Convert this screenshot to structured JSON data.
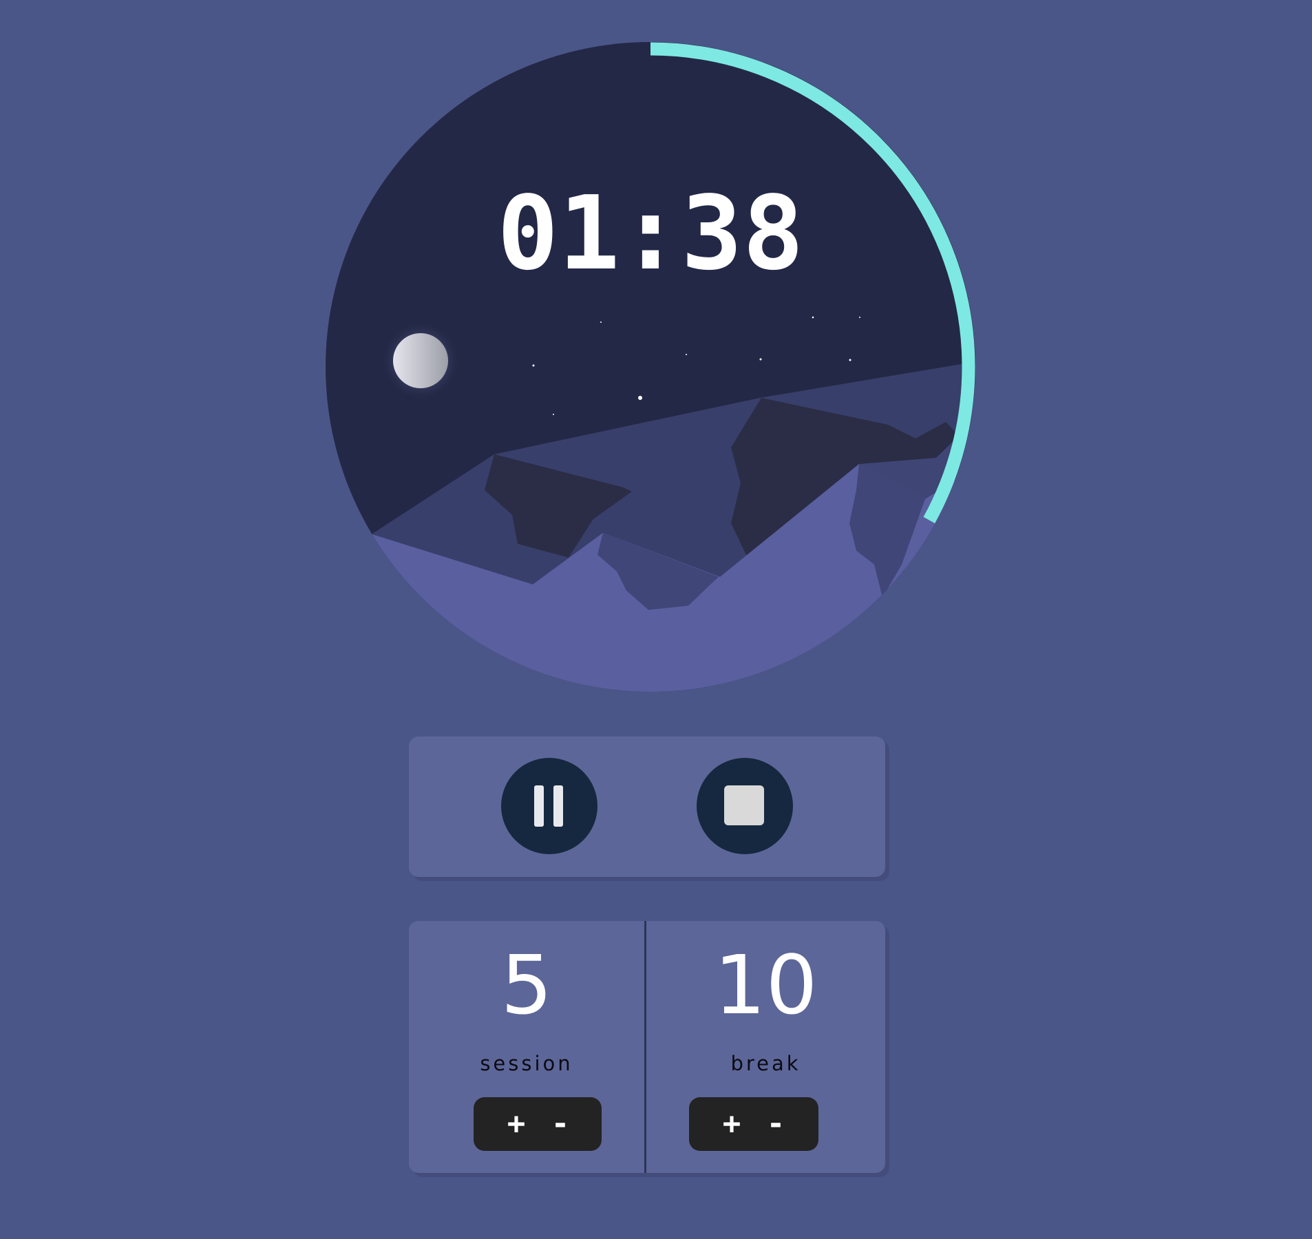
{
  "timer": {
    "display": "01:38",
    "progress": 0.33
  },
  "controls": {
    "pause_icon": "pause-icon",
    "stop_icon": "stop-icon"
  },
  "session": {
    "value": "5",
    "label": "session",
    "plus": "+",
    "minus": "-"
  },
  "break": {
    "value": "10",
    "label": "break",
    "plus": "+",
    "minus": "-"
  },
  "colors": {
    "background": "#4b5688",
    "sky": "#242847",
    "progress_ring": "#7ee9e2",
    "panel": "#5d6698",
    "button": "#15283f",
    "stepper": "#232323"
  }
}
